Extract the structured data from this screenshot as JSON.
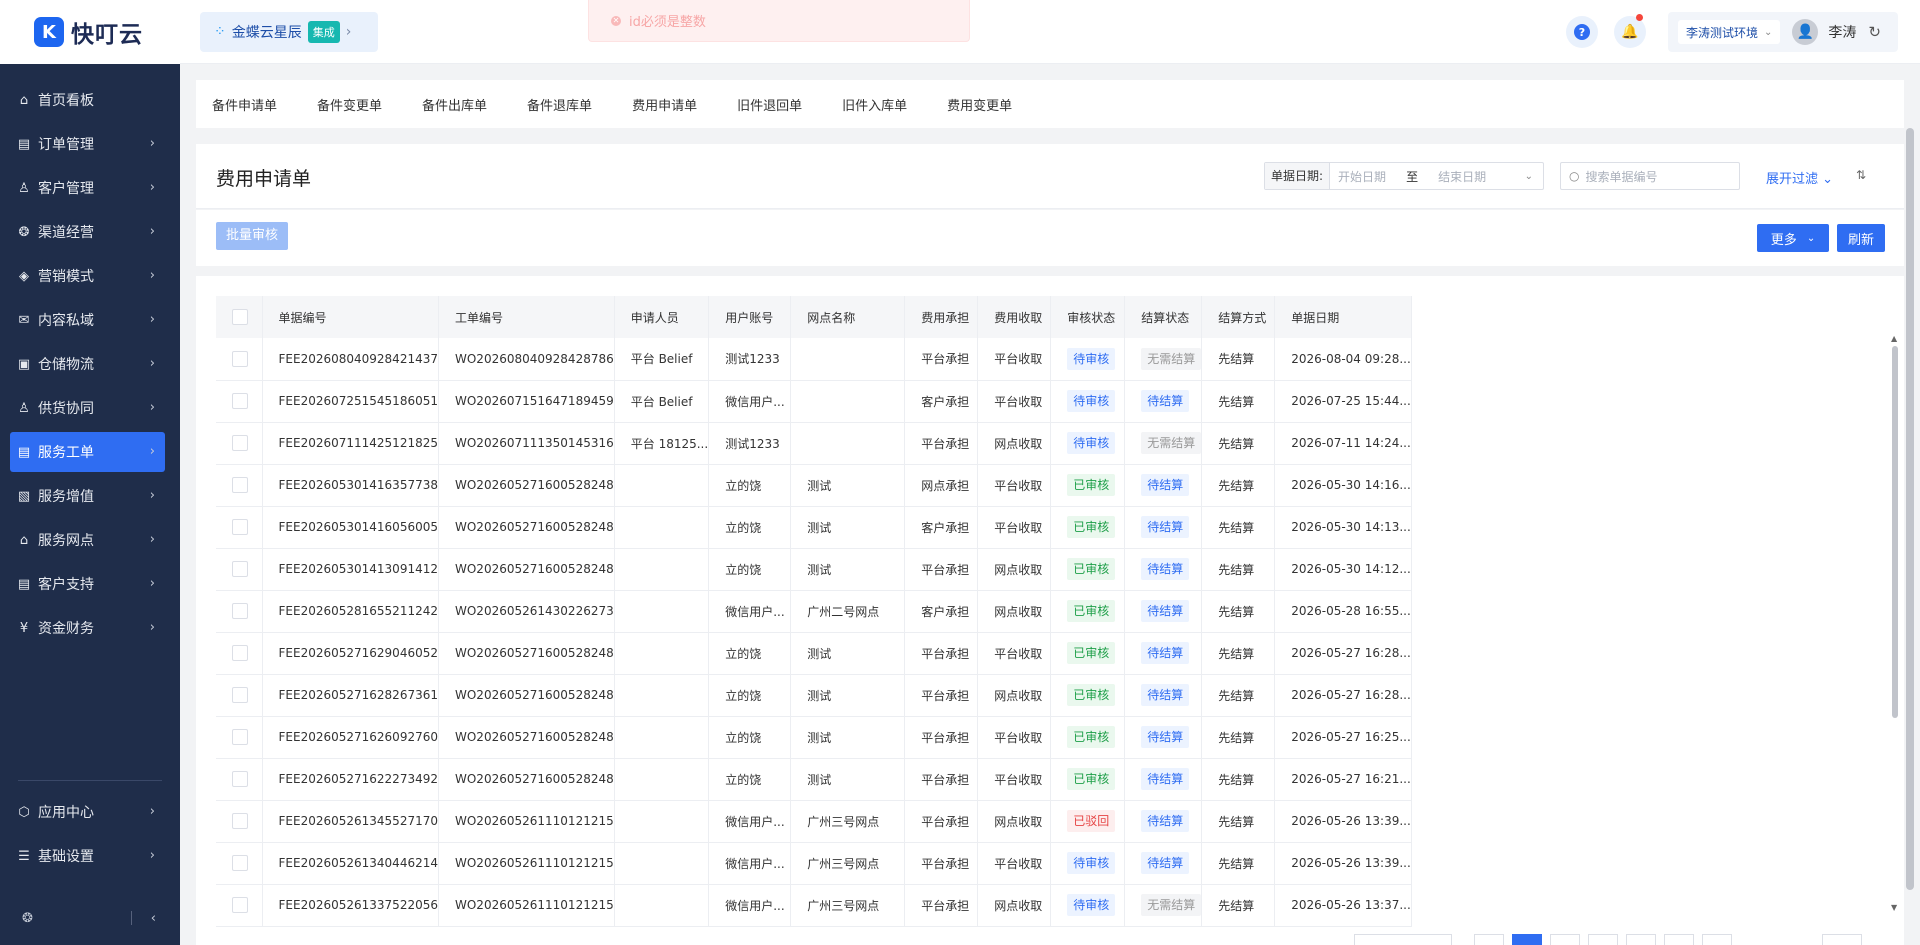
{
  "app": {
    "name": "快叮云",
    "logo_letter": "K"
  },
  "brand_chip": {
    "label": "金蝶云星辰",
    "tag": "集成"
  },
  "toast": {
    "message": "id必须是整数"
  },
  "header": {
    "env": "李涛测试环境",
    "user": "李涛"
  },
  "sidebar": {
    "items": [
      {
        "label": "首页看板",
        "icon": "home-icon",
        "glyph": "⌂",
        "chev": ""
      },
      {
        "label": "订单管理",
        "icon": "order-icon",
        "glyph": "▤",
        "chev": "›"
      },
      {
        "label": "客户管理",
        "icon": "customer-icon",
        "glyph": "♙",
        "chev": "›"
      },
      {
        "label": "渠道经营",
        "icon": "channel-icon",
        "glyph": "❂",
        "chev": "›"
      },
      {
        "label": "营销模式",
        "icon": "marketing-icon",
        "glyph": "◈",
        "chev": "›"
      },
      {
        "label": "内容私域",
        "icon": "content-icon",
        "glyph": "✉",
        "chev": "›"
      },
      {
        "label": "仓储物流",
        "icon": "warehouse-icon",
        "glyph": "▣",
        "chev": "›"
      },
      {
        "label": "供货协同",
        "icon": "supply-icon",
        "glyph": "♙",
        "chev": "›"
      },
      {
        "label": "服务工单",
        "icon": "service-order-icon",
        "glyph": "▤",
        "chev": "›",
        "active": true
      },
      {
        "label": "服务增值",
        "icon": "value-added-icon",
        "glyph": "▧",
        "chev": "›"
      },
      {
        "label": "服务网点",
        "icon": "outlet-icon",
        "glyph": "⌂",
        "chev": "›"
      },
      {
        "label": "客户支持",
        "icon": "support-icon",
        "glyph": "▤",
        "chev": "›"
      },
      {
        "label": "资金财务",
        "icon": "finance-icon",
        "glyph": "¥",
        "chev": "›"
      }
    ],
    "bottom_items": [
      {
        "label": "应用中心",
        "icon": "app-center-icon",
        "glyph": "⬡",
        "chev": "›"
      },
      {
        "label": "基础设置",
        "icon": "settings-icon",
        "glyph": "☰",
        "chev": "›"
      }
    ]
  },
  "subtabs": [
    "备件申请单",
    "备件变更单",
    "备件出库单",
    "备件退库单",
    "费用申请单",
    "旧件退回单",
    "旧件入库单",
    "费用变更单"
  ],
  "page": {
    "title": "费用申请单",
    "date_label": "单据日期:",
    "start_placeholder": "开始日期",
    "to": "至",
    "end_placeholder": "结束日期",
    "search_placeholder": "搜索单据编号",
    "expand_filter": "展开过滤",
    "batch_review": "批量审核",
    "more": "更多",
    "refresh": "刷新"
  },
  "table": {
    "columns": [
      "单据编号",
      "工单编号",
      "申请人员",
      "用户账号",
      "网点名称",
      "费用承担",
      "费用收取",
      "审核状态",
      "结算状态",
      "结算方式",
      "单据日期"
    ],
    "rows": [
      [
        "FEE202608040928421437",
        "WO202608040928428786",
        "平台 Belief",
        "测试1233",
        "",
        "平台承担",
        "平台收取",
        "待审核",
        "无需结算",
        "先结算",
        "2026-08-04 09:28..."
      ],
      [
        "FEE202607251545186051",
        "WO202607151647189459",
        "平台 Belief",
        "微信用户...",
        "",
        "客户承担",
        "平台收取",
        "待审核",
        "待结算",
        "先结算",
        "2026-07-25 15:44..."
      ],
      [
        "FEE202607111425121825",
        "WO202607111350145316",
        "平台 18125...",
        "测试1233",
        "",
        "平台承担",
        "网点收取",
        "待审核",
        "无需结算",
        "先结算",
        "2026-07-11 14:24..."
      ],
      [
        "FEE202605301416357738",
        "WO202605271600528248",
        "",
        "立的饶",
        "测试",
        "网点承担",
        "平台收取",
        "已审核",
        "待结算",
        "先结算",
        "2026-05-30 14:16..."
      ],
      [
        "FEE202605301416056005",
        "WO202605271600528248",
        "",
        "立的饶",
        "测试",
        "客户承担",
        "平台收取",
        "已审核",
        "待结算",
        "先结算",
        "2026-05-30 14:13..."
      ],
      [
        "FEE202605301413091412",
        "WO202605271600528248",
        "",
        "立的饶",
        "测试",
        "平台承担",
        "网点收取",
        "已审核",
        "待结算",
        "先结算",
        "2026-05-30 14:12..."
      ],
      [
        "FEE202605281655211242",
        "WO202605261430226273",
        "",
        "微信用户...",
        "广州二号网点",
        "客户承担",
        "网点收取",
        "已审核",
        "待结算",
        "先结算",
        "2026-05-28 16:55..."
      ],
      [
        "FEE202605271629046052",
        "WO202605271600528248",
        "",
        "立的饶",
        "测试",
        "平台承担",
        "平台收取",
        "已审核",
        "待结算",
        "先结算",
        "2026-05-27 16:28..."
      ],
      [
        "FEE202605271628267361",
        "WO202605271600528248",
        "",
        "立的饶",
        "测试",
        "平台承担",
        "网点收取",
        "已审核",
        "待结算",
        "先结算",
        "2026-05-27 16:28..."
      ],
      [
        "FEE202605271626092760",
        "WO202605271600528248",
        "",
        "立的饶",
        "测试",
        "平台承担",
        "平台收取",
        "已审核",
        "待结算",
        "先结算",
        "2026-05-27 16:25..."
      ],
      [
        "FEE202605271622273492",
        "WO202605271600528248",
        "",
        "立的饶",
        "测试",
        "平台承担",
        "平台收取",
        "已审核",
        "待结算",
        "先结算",
        "2026-05-27 16:21..."
      ],
      [
        "FEE202605261345527170",
        "WO202605261110121215",
        "",
        "微信用户...",
        "广州三号网点",
        "平台承担",
        "网点收取",
        "已驳回",
        "待结算",
        "先结算",
        "2026-05-26 13:39..."
      ],
      [
        "FEE202605261340446214",
        "WO202605261110121215",
        "",
        "微信用户...",
        "广州三号网点",
        "平台承担",
        "平台收取",
        "待审核",
        "待结算",
        "先结算",
        "2026-05-26 13:39..."
      ],
      [
        "FEE202605261337522056",
        "WO202605261110121215",
        "",
        "微信用户...",
        "广州三号网点",
        "平台承担",
        "网点收取",
        "待审核",
        "无需结算",
        "先结算",
        "2026-05-26 13:37..."
      ]
    ]
  },
  "colors": {
    "accent": "#2f6df2",
    "sidebar_bg": "#1f2d4a"
  }
}
